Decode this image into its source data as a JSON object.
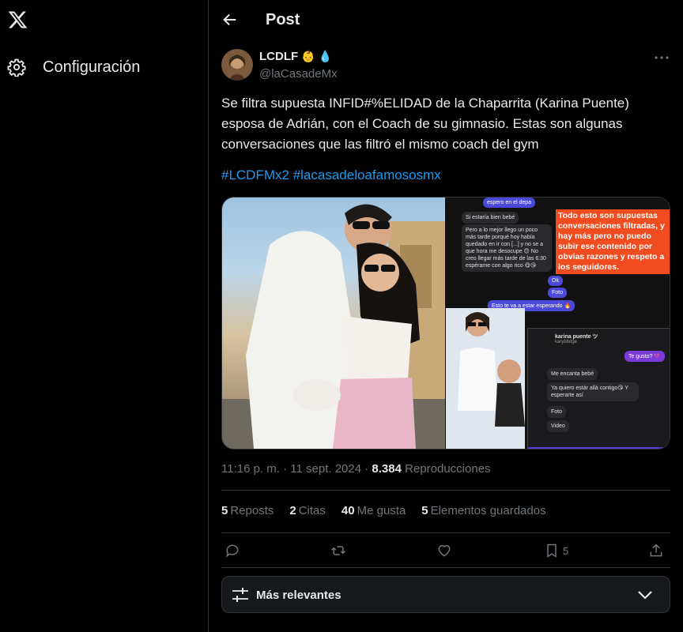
{
  "nav": {
    "settings_label": "Configuración"
  },
  "header": {
    "title": "Post"
  },
  "tweet": {
    "author_name": "LCDLF",
    "author_emojis": "👶 💧",
    "handle": "@laCasadeMx",
    "text": "Se filtra supuesta ІNFІD#%ELІDAD de la Chaparrita (Karina Puente) esposa de Adrián, con el Coach de su gimnasio. Estas son algunas conversaciones que las filtró el mismo coach del gym",
    "hashtags": [
      "#LCDFMx2",
      "#lacasadeloafamososmx"
    ],
    "time": "11:16 p. m.",
    "date": "11 sept. 2024",
    "views_count": "8.384",
    "views_label": "Reproducciones",
    "stats": [
      {
        "count": "5",
        "label": "Reposts"
      },
      {
        "count": "2",
        "label": "Citas"
      },
      {
        "count": "40",
        "label": "Me gusta"
      },
      {
        "count": "5",
        "label": "Elementos guardados"
      }
    ],
    "bookmark_count": "5"
  },
  "media": {
    "chat_lines": [
      "espero en el depa",
      "Si estaría bien bebé",
      "Pero a lo mejor llego un poco más tarde porqué hoy había quedado en ir con [...] y no se a que hora me desocupe 😊 No creo llegar más tarde de las 6:30 espérame con algo rico 😋😘",
      "Ok",
      "Foto",
      "Esto te va a estar esperando 🔥"
    ],
    "overlay_note": "Todo esto son supuestas conversaciones filtradas, y hay más pero no puedo subir ese contenido por obvias razones y respeto a los seguidores.",
    "insta_name": "karina puente ツ",
    "insta_handle": "karyb6dge",
    "insta_msgs": [
      "Te gusto? 💜",
      "Me encanta bebé",
      "Ya quiero estár allá contigo😘 Y esperarte así",
      "Foto",
      "Video"
    ]
  },
  "replies": {
    "sort_label": "Más relevantes"
  },
  "colors": {
    "accent": "#1d9bf0",
    "background": "#000000",
    "border": "#2f3336",
    "secondary_text": "#71767b"
  }
}
